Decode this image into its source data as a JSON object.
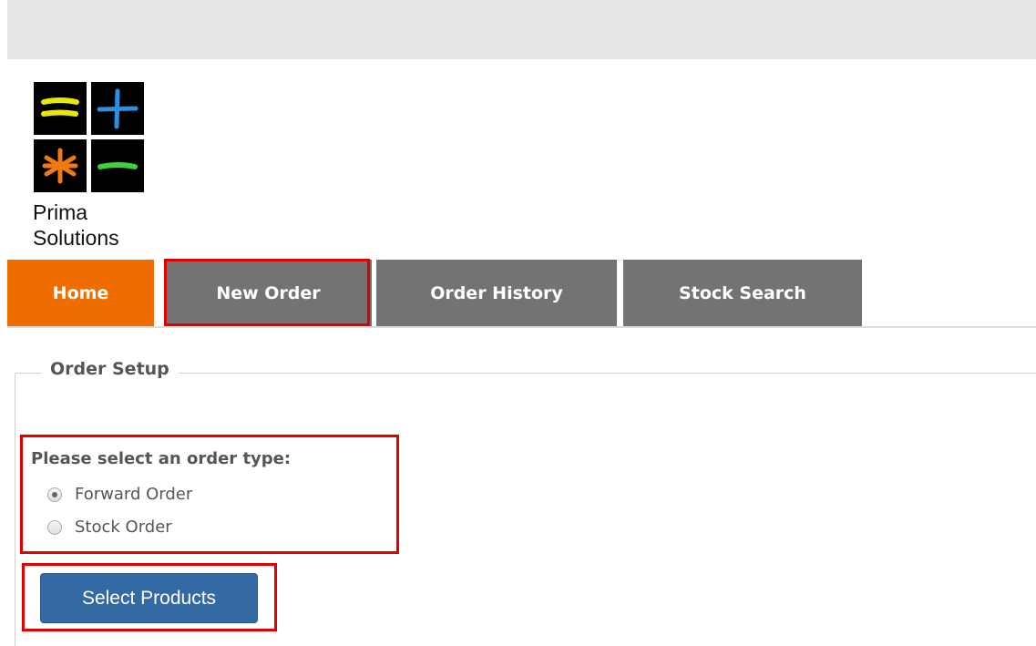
{
  "brand": {
    "name_line1": "Prima",
    "name_line2": "Solutions",
    "logo_icons": [
      "equals-icon",
      "plus-icon",
      "asterisk-icon",
      "minus-icon"
    ],
    "logo_colors": {
      "background": "#000000",
      "equals": "#e7e70a",
      "plus": "#2d8fe0",
      "asterisk": "#f07a10",
      "minus": "#3ed13e"
    }
  },
  "nav": {
    "tabs": [
      {
        "label": "Home",
        "active": true
      },
      {
        "label": "New Order",
        "active": false
      },
      {
        "label": "Order History",
        "active": false
      },
      {
        "label": "Stock Search",
        "active": false
      }
    ]
  },
  "order_setup": {
    "legend": "Order Setup",
    "prompt": "Please select an order type:",
    "options": [
      {
        "label": "Forward Order",
        "checked": true
      },
      {
        "label": "Stock Order",
        "checked": false
      }
    ],
    "button_label": "Select Products"
  },
  "colors": {
    "accent_orange": "#ef6c00",
    "tab_gray": "#737373",
    "button_blue": "#346aa3",
    "highlight_red": "#e00000"
  }
}
